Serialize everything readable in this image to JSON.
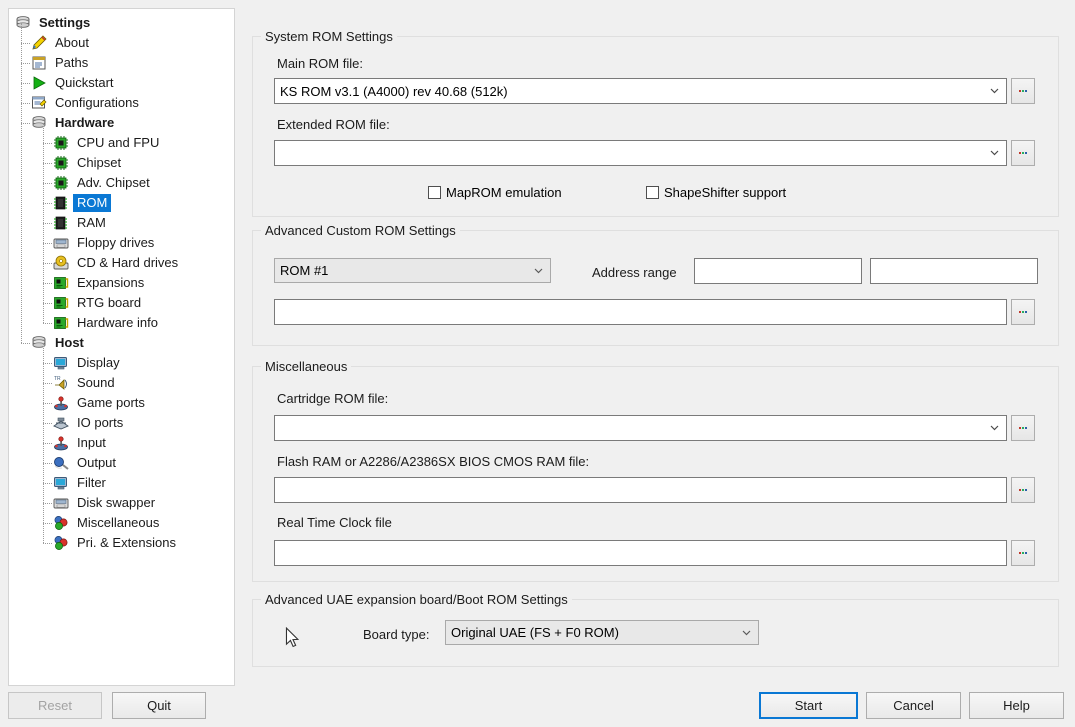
{
  "tree": {
    "items": [
      {
        "label": "Settings",
        "icon": "stack-icon",
        "depth": 0,
        "bold": true,
        "selected": false
      },
      {
        "label": "About",
        "icon": "pencil-icon",
        "depth": 1,
        "bold": false,
        "selected": false
      },
      {
        "label": "Paths",
        "icon": "paths-icon",
        "depth": 1,
        "bold": false,
        "selected": false
      },
      {
        "label": "Quickstart",
        "icon": "play-icon",
        "depth": 1,
        "bold": false,
        "selected": false
      },
      {
        "label": "Configurations",
        "icon": "config-icon",
        "depth": 1,
        "bold": false,
        "selected": false
      },
      {
        "label": "Hardware",
        "icon": "stack-icon",
        "depth": 1,
        "bold": true,
        "selected": false
      },
      {
        "label": "CPU and FPU",
        "icon": "chip-icon",
        "depth": 2,
        "bold": false,
        "selected": false
      },
      {
        "label": "Chipset",
        "icon": "chip-icon",
        "depth": 2,
        "bold": false,
        "selected": false
      },
      {
        "label": "Adv. Chipset",
        "icon": "chip-icon",
        "depth": 2,
        "bold": false,
        "selected": false
      },
      {
        "label": "ROM",
        "icon": "memory-icon",
        "depth": 2,
        "bold": false,
        "selected": true
      },
      {
        "label": "RAM",
        "icon": "memory-icon",
        "depth": 2,
        "bold": false,
        "selected": false
      },
      {
        "label": "Floppy drives",
        "icon": "floppy-icon",
        "depth": 2,
        "bold": false,
        "selected": false
      },
      {
        "label": "CD & Hard drives",
        "icon": "cd-icon",
        "depth": 2,
        "bold": false,
        "selected": false
      },
      {
        "label": "Expansions",
        "icon": "board-icon",
        "depth": 2,
        "bold": false,
        "selected": false
      },
      {
        "label": "RTG board",
        "icon": "board-icon",
        "depth": 2,
        "bold": false,
        "selected": false
      },
      {
        "label": "Hardware info",
        "icon": "board-icon",
        "depth": 2,
        "bold": false,
        "selected": false
      },
      {
        "label": "Host",
        "icon": "stack-icon",
        "depth": 1,
        "bold": true,
        "selected": false
      },
      {
        "label": "Display",
        "icon": "monitor-icon",
        "depth": 2,
        "bold": false,
        "selected": false
      },
      {
        "label": "Sound",
        "icon": "sound-icon",
        "depth": 2,
        "bold": false,
        "selected": false
      },
      {
        "label": "Game ports",
        "icon": "joystick-icon",
        "depth": 2,
        "bold": false,
        "selected": false
      },
      {
        "label": "IO ports",
        "icon": "ioports-icon",
        "depth": 2,
        "bold": false,
        "selected": false
      },
      {
        "label": "Input",
        "icon": "joystick-icon",
        "depth": 2,
        "bold": false,
        "selected": false
      },
      {
        "label": "Output",
        "icon": "output-icon",
        "depth": 2,
        "bold": false,
        "selected": false
      },
      {
        "label": "Filter",
        "icon": "monitor-icon",
        "depth": 2,
        "bold": false,
        "selected": false
      },
      {
        "label": "Disk swapper",
        "icon": "floppy-icon",
        "depth": 2,
        "bold": false,
        "selected": false
      },
      {
        "label": "Miscellaneous",
        "icon": "spheres-icon",
        "depth": 2,
        "bold": false,
        "selected": false
      },
      {
        "label": "Pri. & Extensions",
        "icon": "spheres-icon",
        "depth": 2,
        "bold": false,
        "selected": false
      }
    ]
  },
  "system_rom": {
    "legend": "System ROM Settings",
    "main_rom_label": "Main ROM file:",
    "main_rom_value": "KS ROM v3.1 (A4000) rev 40.68 (512k)",
    "extended_rom_label": "Extended ROM file:",
    "extended_rom_value": "",
    "maprom_label": "MapROM emulation",
    "maprom_checked": false,
    "shapeshifter_label": "ShapeShifter support",
    "shapeshifter_checked": false,
    "browse_label": "..."
  },
  "advanced_custom_rom": {
    "legend": "Advanced Custom ROM Settings",
    "rom_select_value": "ROM #1",
    "rom_select_disabled": true,
    "address_range_label": "Address range",
    "address_start_value": "",
    "address_end_value": "",
    "custom_rom_path_value": "",
    "browse_label": "..."
  },
  "miscellaneous": {
    "legend": "Miscellaneous",
    "cartridge_label": "Cartridge ROM file:",
    "cartridge_value": "",
    "flash_label": "Flash RAM or A2286/A2386SX BIOS CMOS RAM file:",
    "flash_value": "",
    "rtc_label": "Real Time Clock file",
    "rtc_value": "",
    "browse_label": "..."
  },
  "uae_board": {
    "legend": "Advanced UAE expansion board/Boot ROM Settings",
    "board_type_label": "Board type:",
    "board_type_value": "Original UAE (FS + F0 ROM)"
  },
  "footer": {
    "reset_label": "Reset",
    "reset_disabled": true,
    "quit_label": "Quit",
    "start_label": "Start",
    "start_focused": true,
    "cancel_label": "Cancel",
    "help_label": "Help"
  },
  "colors": {
    "window_bg": "#f0f0f0",
    "panel_bg": "#ffffff",
    "selection_blue": "#0a78d4",
    "focus_blue": "#0a78d4",
    "border_grey": "#dfdfdf",
    "field_border": "#7a7a7a",
    "disabled_text": "#a3a3a3"
  }
}
